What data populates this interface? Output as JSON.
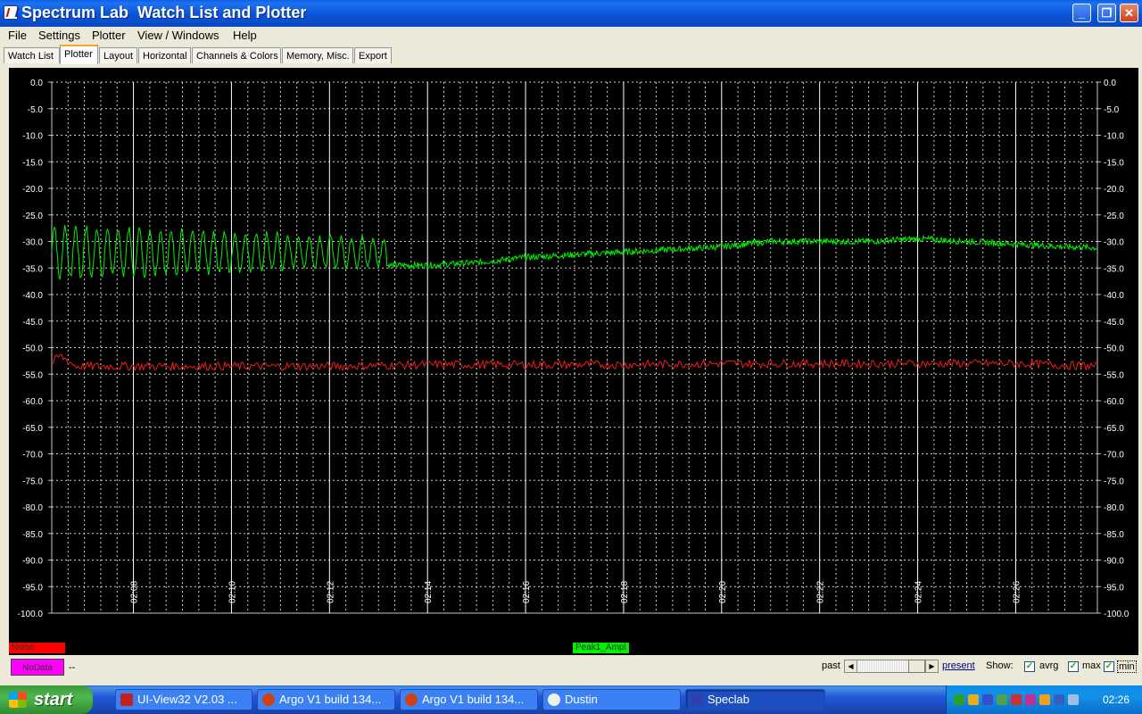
{
  "window": {
    "title": "Spectrum Lab  Watch List and Plotter",
    "minimize_label": "_",
    "maximize_label": "❐",
    "close_label": "✕"
  },
  "menu": [
    "File",
    "Settings",
    "Plotter",
    "View / Windows",
    "Help"
  ],
  "tabs": [
    "Watch List",
    "Plotter",
    "Layout",
    "Horizontal",
    "Channels & Colors",
    "Memory, Misc.",
    "Export"
  ],
  "active_tab": "Plotter",
  "chart_data": {
    "type": "line",
    "x_unit": "time (hh:mm)",
    "xlim": [
      "02:06:20",
      "02:27:40"
    ],
    "ylim": [
      -100,
      0
    ],
    "y_ticks": [
      "0.0",
      "-5.0",
      "-10.0",
      "-15.0",
      "-20.0",
      "-25.0",
      "-30.0",
      "-35.0",
      "-40.0",
      "-45.0",
      "-50.0",
      "-55.0",
      "-60.0",
      "-65.0",
      "-70.0",
      "-75.0",
      "-80.0",
      "-85.0",
      "-90.0",
      "-95.0",
      "-100.0"
    ],
    "x_ticks": [
      "02:08",
      "02:10",
      "02:12",
      "02:14",
      "02:16",
      "02:18",
      "02:20",
      "02:22",
      "02:24",
      "02:26"
    ],
    "grid": true,
    "background": "#000000",
    "series": [
      {
        "name": "Peak1_Ampl",
        "color": "#00ee00",
        "segments": [
          {
            "from": "02:06:20",
            "to": "02:13:10",
            "pattern": "oscillation",
            "center": -32.0,
            "amplitude_start": 5.0,
            "amplitude_end": 2.5,
            "period_s": 13
          },
          {
            "from": "02:13:10",
            "to": "02:27:40",
            "pattern": "trend",
            "x": [
              "02:13:10",
              "02:14:00",
              "02:15:00",
              "02:16:00",
              "02:17:00",
              "02:18:00",
              "02:19:00",
              "02:20:00",
              "02:21:00",
              "02:22:00",
              "02:23:00",
              "02:24:00",
              "02:25:00",
              "02:26:00",
              "02:27:00",
              "02:27:40"
            ],
            "y": [
              -34.5,
              -34.5,
              -34.0,
              -33.0,
              -32.5,
              -32.0,
              -31.5,
              -31.0,
              -30.0,
              -30.0,
              -30.0,
              -29.5,
              -30.0,
              -30.5,
              -31.0,
              -31.2
            ],
            "noise": 0.6
          }
        ]
      },
      {
        "name": "Noise",
        "color": "#ee1c1c",
        "x": [
          "02:06:20",
          "02:06:30",
          "02:06:50",
          "02:08:00",
          "02:10:00",
          "02:12:00",
          "02:14:00",
          "02:16:00",
          "02:18:00",
          "02:20:00",
          "02:22:00",
          "02:24:00",
          "02:26:00",
          "02:27:40"
        ],
        "y": [
          -53.0,
          -51.5,
          -53.5,
          -53.5,
          -53.5,
          -53.5,
          -53.2,
          -53.2,
          -53.2,
          -53.0,
          -53.0,
          -53.0,
          -53.0,
          -53.5
        ],
        "noise": 0.8
      }
    ],
    "legend": [
      {
        "label": "Noise",
        "color": "#ff0000"
      },
      {
        "label": "Peak1_Ampl",
        "color": "#00ee00"
      }
    ]
  },
  "status": {
    "nodata_label": "NoData",
    "dash_text": "--",
    "past_label": "past",
    "present_label": "present",
    "show_label": "Show:",
    "checkboxes": [
      {
        "label": "avrg",
        "checked": true
      },
      {
        "label": "max",
        "checked": true
      },
      {
        "label": "min",
        "checked": true
      }
    ]
  },
  "taskbar": {
    "start_label": "start",
    "tasks": [
      {
        "label": "UI-View32 V2.03 ...",
        "icon_color": "#c02020"
      },
      {
        "label": "Argo V1 build 134...",
        "icon_color": "#d04010"
      },
      {
        "label": "Argo V1 build 134...",
        "icon_color": "#d04010"
      },
      {
        "label": "Dustin",
        "icon_color": "#f0f0f0"
      },
      {
        "label": "Speclab",
        "icon_color": "#3040b0"
      }
    ],
    "tray_icon_colors": [
      "#2aa02a",
      "#e0b020",
      "#3050d0",
      "#50a050",
      "#d03030",
      "#c03090",
      "#f0a020",
      "#3060c0",
      "#a0c0e0"
    ],
    "clock": "02:26"
  }
}
